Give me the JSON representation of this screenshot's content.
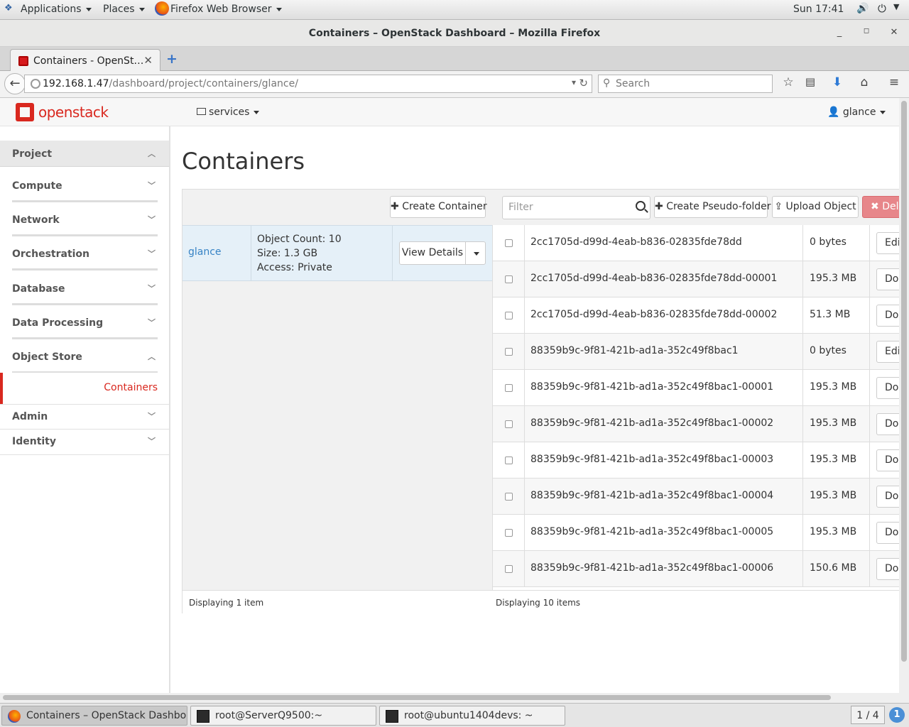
{
  "desktop": {
    "applications_label": "Applications",
    "places_label": "Places",
    "active_app_label": "Firefox Web Browser",
    "clock": "Sun 17:41"
  },
  "window": {
    "title": "Containers – OpenStack Dashboard – Mozilla Firefox"
  },
  "browser": {
    "tab_label": "Containers - OpenSt…",
    "url_host": "192.168.1.47",
    "url_path": "/dashboard/project/containers/glance/",
    "search_placeholder": "Search"
  },
  "header": {
    "logo_text": "openstack",
    "services_label": "services",
    "user_label": "glance"
  },
  "sidebar": {
    "sections": [
      {
        "label": "Project",
        "expanded": true
      },
      {
        "label": "Compute",
        "expanded": false
      },
      {
        "label": "Network",
        "expanded": false
      },
      {
        "label": "Orchestration",
        "expanded": false
      },
      {
        "label": "Database",
        "expanded": false
      },
      {
        "label": "Data Processing",
        "expanded": false
      },
      {
        "label": "Object Store",
        "expanded": true
      },
      {
        "label": "Admin",
        "expanded": false
      },
      {
        "label": "Identity",
        "expanded": false
      }
    ],
    "active_item": "Containers"
  },
  "main": {
    "page_title": "Containers",
    "create_container_label": "Create Container",
    "container": {
      "name": "glance",
      "object_count": "Object Count: 10",
      "size": "Size: 1.3 GB",
      "access": "Access: Private",
      "view_details_label": "View Details"
    },
    "left_footer": "Displaying 1 item",
    "filter_placeholder": "Filter",
    "create_pseudo_folder_label": "Create Pseudo-folder",
    "upload_object_label": "Upload Object",
    "delete_label": "Dele",
    "objects": [
      {
        "name": "2cc1705d-d99d-4eab-b836-02835fde78dd",
        "size": "0 bytes",
        "action": "Edit"
      },
      {
        "name": "2cc1705d-d99d-4eab-b836-02835fde78dd-00001",
        "size": "195.3 MB",
        "action": "Dow"
      },
      {
        "name": "2cc1705d-d99d-4eab-b836-02835fde78dd-00002",
        "size": "51.3 MB",
        "action": "Dow"
      },
      {
        "name": "88359b9c-9f81-421b-ad1a-352c49f8bac1",
        "size": "0 bytes",
        "action": "Edit"
      },
      {
        "name": "88359b9c-9f81-421b-ad1a-352c49f8bac1-00001",
        "size": "195.3 MB",
        "action": "Dow"
      },
      {
        "name": "88359b9c-9f81-421b-ad1a-352c49f8bac1-00002",
        "size": "195.3 MB",
        "action": "Dow"
      },
      {
        "name": "88359b9c-9f81-421b-ad1a-352c49f8bac1-00003",
        "size": "195.3 MB",
        "action": "Dow"
      },
      {
        "name": "88359b9c-9f81-421b-ad1a-352c49f8bac1-00004",
        "size": "195.3 MB",
        "action": "Dow"
      },
      {
        "name": "88359b9c-9f81-421b-ad1a-352c49f8bac1-00005",
        "size": "195.3 MB",
        "action": "Dow"
      },
      {
        "name": "88359b9c-9f81-421b-ad1a-352c49f8bac1-00006",
        "size": "150.6 MB",
        "action": "Dow"
      }
    ],
    "right_footer": "Displaying 10 items"
  },
  "taskbar": {
    "items": [
      {
        "label": "Containers – OpenStack Dashboar…",
        "icon": "firefox-icon",
        "active": true
      },
      {
        "label": "root@ServerQ9500:~",
        "icon": "terminal-icon",
        "active": false
      },
      {
        "label": "root@ubuntu1404devs: ~",
        "icon": "terminal-icon",
        "active": false
      }
    ],
    "workspace": "1 / 4",
    "notification_count": "1"
  },
  "colors": {
    "brand_red": "#d9281f",
    "link_blue": "#3783c5",
    "danger_button": "#e7868a"
  }
}
